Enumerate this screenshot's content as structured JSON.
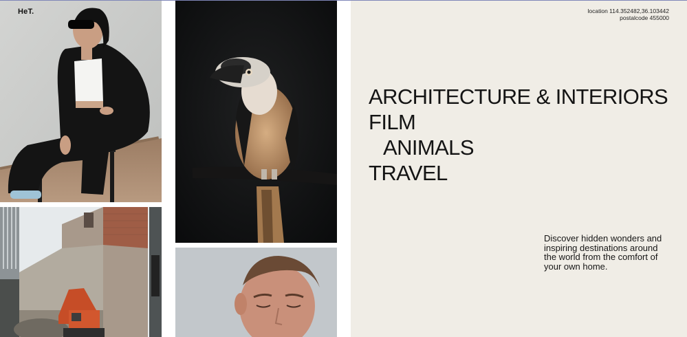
{
  "brand": {
    "logo": "HeT."
  },
  "location": {
    "line1": "location 114.352482,36.103442",
    "line2": "postalcode 455000"
  },
  "categories": [
    {
      "label": "ARCHITECTURE & INTERIORS"
    },
    {
      "label": "FILM"
    },
    {
      "label": "ANIMALS"
    },
    {
      "label": "TRAVEL"
    }
  ],
  "tagline": "Discover hidden wonders and inspiring destinations around the world from the comfort of your own home.",
  "colors": {
    "panel": "#f0ede6",
    "text": "#141414",
    "top_line": "#7f86b8"
  },
  "photos": [
    {
      "name": "woman-in-black-suit-photo",
      "icon": "portrait-photo"
    },
    {
      "name": "building-excavator-photo",
      "icon": "architecture-photo"
    },
    {
      "name": "hornbill-bird-photo",
      "icon": "animal-photo"
    },
    {
      "name": "man-portrait-photo",
      "icon": "portrait-photo"
    }
  ]
}
